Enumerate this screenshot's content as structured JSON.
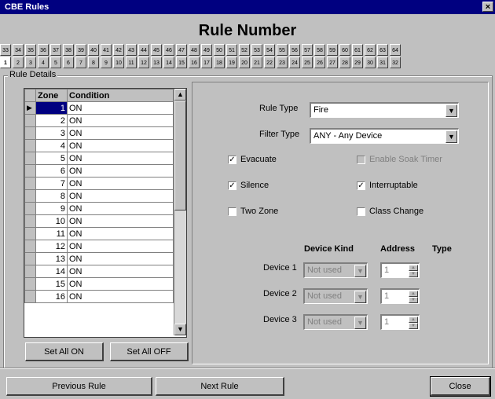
{
  "window": {
    "title": "CBE Rules",
    "close": "×"
  },
  "heading": "Rule Number",
  "tabs_top": [
    "33",
    "34",
    "35",
    "36",
    "37",
    "38",
    "39",
    "40",
    "41",
    "42",
    "43",
    "44",
    "45",
    "46",
    "47",
    "48",
    "49",
    "50",
    "51",
    "52",
    "53",
    "54",
    "55",
    "56",
    "57",
    "58",
    "59",
    "60",
    "61",
    "62",
    "63",
    "64"
  ],
  "tabs_bottom": [
    "1",
    "2",
    "3",
    "4",
    "5",
    "6",
    "7",
    "8",
    "9",
    "10",
    "11",
    "12",
    "13",
    "14",
    "15",
    "16",
    "17",
    "18",
    "19",
    "20",
    "21",
    "22",
    "23",
    "24",
    "25",
    "26",
    "27",
    "28",
    "29",
    "30",
    "31",
    "32"
  ],
  "selected_tab": "1",
  "rule_details": {
    "label": "Rule Details",
    "columns": {
      "zone": "Zone",
      "condition": "Condition"
    },
    "rows": [
      {
        "zone": "1",
        "condition": "ON"
      },
      {
        "zone": "2",
        "condition": "ON"
      },
      {
        "zone": "3",
        "condition": "ON"
      },
      {
        "zone": "4",
        "condition": "ON"
      },
      {
        "zone": "5",
        "condition": "ON"
      },
      {
        "zone": "6",
        "condition": "ON"
      },
      {
        "zone": "7",
        "condition": "ON"
      },
      {
        "zone": "8",
        "condition": "ON"
      },
      {
        "zone": "9",
        "condition": "ON"
      },
      {
        "zone": "10",
        "condition": "ON"
      },
      {
        "zone": "11",
        "condition": "ON"
      },
      {
        "zone": "12",
        "condition": "ON"
      },
      {
        "zone": "13",
        "condition": "ON"
      },
      {
        "zone": "14",
        "condition": "ON"
      },
      {
        "zone": "15",
        "condition": "ON"
      },
      {
        "zone": "16",
        "condition": "ON"
      }
    ],
    "set_all_on": "Set All ON",
    "set_all_off": "Set All OFF"
  },
  "form": {
    "rule_type_label": "Rule Type",
    "rule_type_value": "Fire",
    "filter_type_label": "Filter Type",
    "filter_type_value": "ANY - Any Device",
    "evacuate": {
      "label": "Evacuate",
      "checked": true
    },
    "enable_soak_timer": {
      "label": "Enable Soak Timer",
      "checked": false,
      "disabled": true
    },
    "silence": {
      "label": "Silence",
      "checked": true
    },
    "interruptable": {
      "label": "Interruptable",
      "checked": true
    },
    "two_zone": {
      "label": "Two Zone",
      "checked": false
    },
    "class_change": {
      "label": "Class Change",
      "checked": false
    },
    "device_headers": {
      "kind": "Device Kind",
      "address": "Address",
      "type": "Type"
    },
    "devices": [
      {
        "label": "Device 1",
        "kind": "Not used",
        "address": "1"
      },
      {
        "label": "Device 2",
        "kind": "Not used",
        "address": "1"
      },
      {
        "label": "Device 3",
        "kind": "Not used",
        "address": "1"
      }
    ]
  },
  "footer": {
    "previous": "Previous Rule",
    "next": "Next Rule",
    "close": "Close"
  }
}
